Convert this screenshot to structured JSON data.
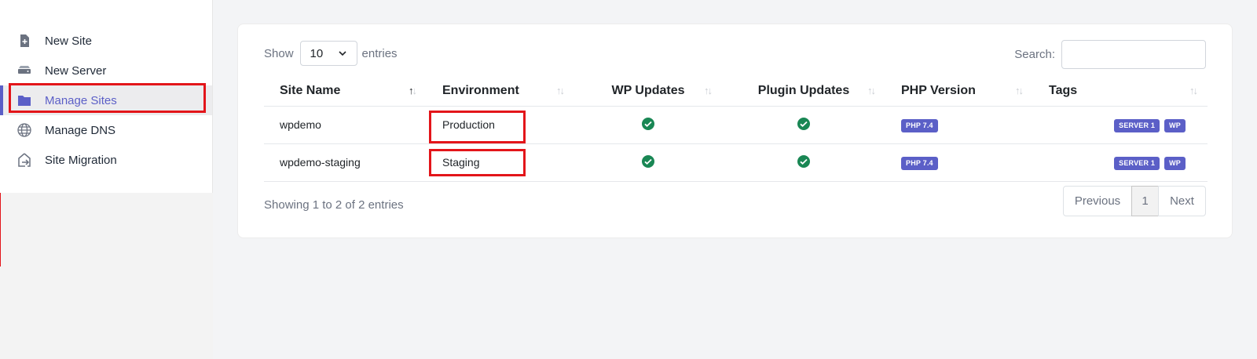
{
  "sidebar": {
    "items": [
      {
        "label": "New Site",
        "icon": "file-plus-icon"
      },
      {
        "label": "New Server",
        "icon": "server-icon"
      },
      {
        "label": "Manage Sites",
        "icon": "folder-icon"
      },
      {
        "label": "Manage DNS",
        "icon": "globe-icon"
      },
      {
        "label": "Site Migration",
        "icon": "migration-icon"
      }
    ],
    "active_index": 2
  },
  "toolbar": {
    "show_label": "Show",
    "page_length": "10",
    "entries_label": "entries",
    "search_label": "Search:",
    "search_value": ""
  },
  "table": {
    "headers": [
      "Site Name",
      "Environment",
      "WP Updates",
      "Plugin Updates",
      "PHP Version",
      "Tags"
    ],
    "rows": [
      {
        "site_name": "wpdemo",
        "environment": "Production",
        "wp_updates": "ok",
        "plugin_updates": "ok",
        "php_version": "PHP 7.4",
        "tags": [
          "SERVER 1",
          "WP"
        ]
      },
      {
        "site_name": "wpdemo-staging",
        "environment": "Staging",
        "wp_updates": "ok",
        "plugin_updates": "ok",
        "php_version": "PHP 7.4",
        "tags": [
          "SERVER 1",
          "WP"
        ]
      }
    ]
  },
  "footer": {
    "info": "Showing 1 to 2 of 2 entries",
    "previous": "Previous",
    "current_page": "1",
    "next": "Next"
  },
  "colors": {
    "accent": "#5b5fc7",
    "highlight": "#e3151a",
    "success": "#198754"
  }
}
